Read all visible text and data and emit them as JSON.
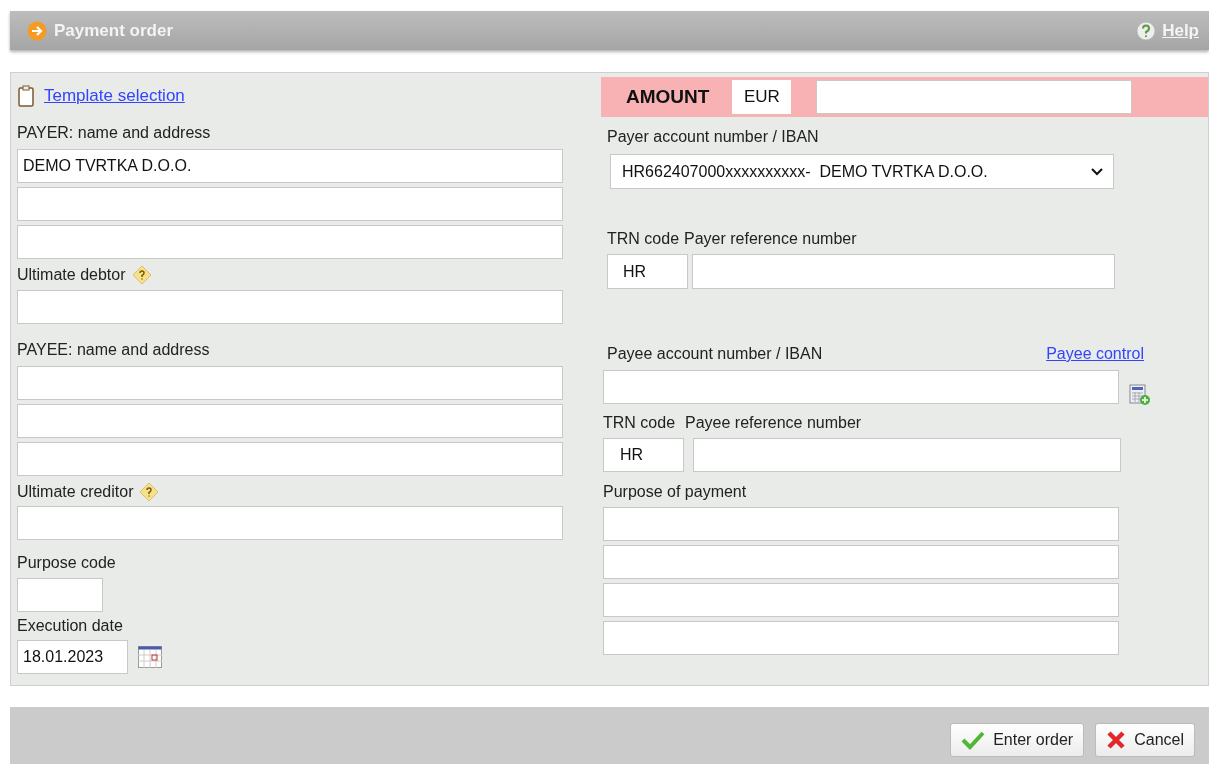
{
  "header": {
    "title": "Payment order",
    "help": "Help"
  },
  "template_link": "Template selection",
  "payer": {
    "label": "PAYER: name and address",
    "lines": [
      {
        "kind": "input",
        "value": "DEMO TVRTKA D.O.O."
      },
      {
        "kind": "input"
      },
      {
        "kind": "input"
      }
    ]
  },
  "ultimate_debtor": {
    "label": "Ultimate debtor"
  },
  "payee": {
    "label": "PAYEE: name and address",
    "lines": [
      {
        "kind": "input"
      },
      {
        "kind": "input"
      },
      {
        "kind": "input"
      }
    ]
  },
  "ultimate_creditor": {
    "label": "Ultimate creditor"
  },
  "purpose_code": {
    "label": "Purpose code"
  },
  "execution_date": {
    "label": "Execution date",
    "value": "18.01.2023"
  },
  "amount": {
    "label": "AMOUNT",
    "currency": "EUR"
  },
  "payer_account": {
    "label": "Payer account number / IBAN",
    "value": "HR662407000xxxxxxxxxx-  DEMO TVRTKA D.O.O."
  },
  "payer_reference": {
    "trn_label": "TRN code",
    "label": "Payer reference number",
    "trn": "HR"
  },
  "payee_account": {
    "label": "Payee account number / IBAN",
    "link": "Payee control"
  },
  "payee_reference": {
    "trn_label": "TRN code",
    "label": "Payee reference number",
    "trn": "HR"
  },
  "purpose": {
    "label": "Purpose of payment",
    "lines": [
      {
        "kind": "input"
      },
      {
        "kind": "input"
      },
      {
        "kind": "input"
      },
      {
        "kind": "input"
      }
    ]
  },
  "buttons": [
    {
      "kind": "confirm",
      "label": "Enter order"
    },
    {
      "kind": "cancel",
      "label": "Cancel"
    }
  ]
}
